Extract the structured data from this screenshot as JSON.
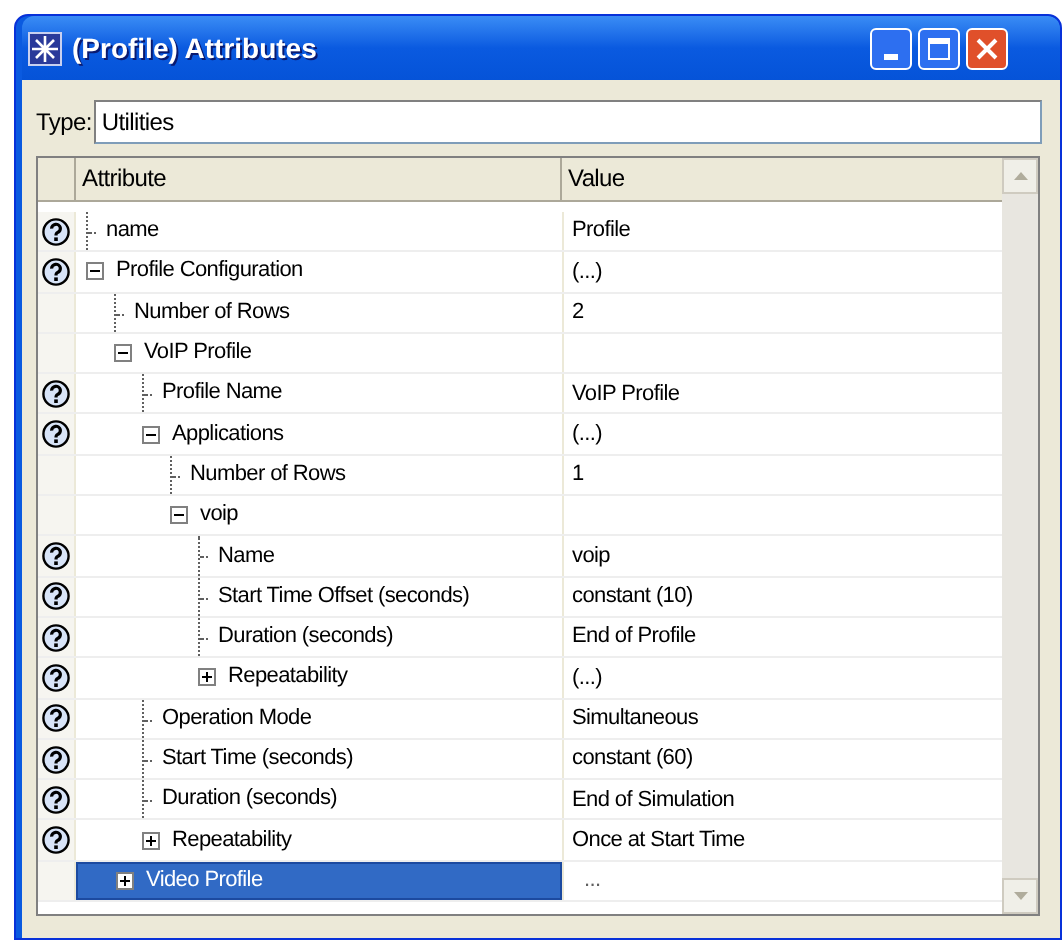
{
  "window": {
    "title": "(Profile) Attributes"
  },
  "type_field": {
    "label": "Type:",
    "value": "Utilities"
  },
  "table": {
    "columns": [
      "Attribute",
      "Value"
    ],
    "rows": [
      {
        "attribute": "name",
        "value": "Profile",
        "help": true,
        "selected": false
      },
      {
        "attribute": "Profile Configuration",
        "value": "(...)",
        "help": true,
        "expanded": true,
        "selected": false,
        "children": [
          {
            "attribute": "Number of Rows",
            "value": "2",
            "help": false,
            "selected": false
          },
          {
            "attribute": "VoIP Profile",
            "help": false,
            "expanded": true,
            "selected": false,
            "children": [
              {
                "attribute": "Profile Name",
                "value": "VoIP Profile",
                "help": true,
                "selected": false
              },
              {
                "attribute": "Applications",
                "value": "(...)",
                "help": true,
                "expanded": true,
                "selected": false,
                "children": [
                  {
                    "attribute": "Number of Rows",
                    "value": "1",
                    "help": false,
                    "selected": false
                  },
                  {
                    "attribute": "voip",
                    "help": false,
                    "expanded": true,
                    "selected": false,
                    "children": [
                      {
                        "attribute": "Name",
                        "value": "voip",
                        "help": true,
                        "selected": false
                      },
                      {
                        "attribute": "Start Time Offset (seconds)",
                        "value": "constant (10)",
                        "help": true,
                        "selected": false
                      },
                      {
                        "attribute": "Duration (seconds)",
                        "value": "End of Profile",
                        "help": true,
                        "selected": false
                      },
                      {
                        "attribute": "Repeatability",
                        "value": "(...)",
                        "help": true,
                        "expanded": false,
                        "selected": false
                      }
                    ]
                  }
                ]
              },
              {
                "attribute": "Operation Mode",
                "value": "Simultaneous",
                "help": true,
                "selected": false
              },
              {
                "attribute": "Start Time (seconds)",
                "value": "constant (60)",
                "help": true,
                "selected": false
              },
              {
                "attribute": "Duration (seconds)",
                "value": "End of Simulation",
                "help": true,
                "selected": false
              },
              {
                "attribute": "Repeatability",
                "value": "Once at Start Time",
                "help": true,
                "expanded": false,
                "selected": false
              }
            ]
          },
          {
            "attribute": "Video Profile",
            "value": "...",
            "help": false,
            "expanded": false,
            "selected": true
          }
        ]
      }
    ]
  }
}
